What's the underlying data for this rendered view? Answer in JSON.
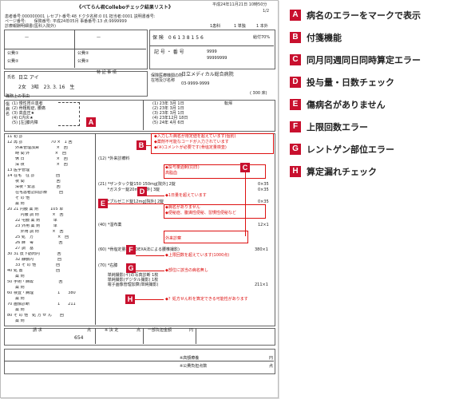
{
  "document": {
    "title": "《べてらん君Colleboチェック結果リスト》",
    "date": "平成24年11月21日 10時50分",
    "page_no": "1/2",
    "meta_line1": "患者番号:000000001 レセプト番号:48 ドクタ名称:0 01 担当者:0001 説明書番号:",
    "meta_line2": "ページ番号:　　保険番号: 平成24年05月 事番番号:13 点:9999999",
    "insurer_label": "診療報酬明細書(医科入院外)",
    "ins_cols": [
      "1患科",
      "1 単独",
      "1 本外"
    ],
    "hoken": "保 険　0 6 1 3 8 1 5 6",
    "kyufu": "給付70%",
    "kigo": "記 号 ・ 番 号",
    "num1": "9999",
    "num2": "99999999",
    "kouhi1": "公費①",
    "kouhi2": "公費②",
    "patient_name_label": "氏名",
    "patient_name": "日立 アイ",
    "tokki": "特 記 事 項",
    "patient_sex": "2女　3昭　23. 3. 16　生",
    "shokumu": "職務上の事由",
    "hospital_label": "保険医療機関の所在地及び名称",
    "hospital_name": "日立メディカル総合病院",
    "hospital_tel": "03-9999-9999",
    "beds": "( 300 床)",
    "diseases": [
      "(1) 慢性胃炎患者",
      "(2) 骨粗鬆症, 腰痛",
      "(3) 高血圧★",
      "(4) C内炎★",
      "(5) [左]膝内障"
    ],
    "disease_dates": [
      "(1) 23年 3月 1日",
      "(2) 23年 3月 1日",
      "(3) 23年 3月 1日",
      "(4) 23年12月 18日",
      "(5) 24年 4月 6日"
    ],
    "tenki": "転帰",
    "treat_lines": [
      "11 初 診",
      "12 再 診　　　　　　　70 ×　1 回",
      "　　外来管理加算　　　　 ×　回",
      "　　時 間 外　　　　　　 ×　回",
      "　　休 日　　　　　　　　×　回",
      "　　深 夜　　　　　　　　×　回",
      "13 医学管理",
      "14 在宅　往 診　　　　　 回",
      "　　夜 間　　　　　　　　回",
      "　　深夜・緊急　　　　　 回",
      "　　在宅患者訪問診療　　　回",
      "　　そ の 他",
      "　　薬 剤",
      "20 21 内服 薬 剤　　　105 単",
      "　　　 内服 調 剤　　　 ×　回",
      "　　22 屯服 薬 剤　　　 単",
      "　　23 外用 薬 剤　　　 単",
      "　　　 外用 調 剤　　　 ×　回",
      "　　25 処　方　　　　　　×　回",
      "　　26 麻　毒　　　　　　 回",
      "　　27 調　基",
      "30 31 皮下筋肉内　　　　 回",
      "　　32 静脈内　　　　　　回",
      "　　33 そ の 他　　　　　回",
      "40 処 置　　　　　　　　 回",
      "　　薬 剤",
      "50 手術・麻酔　　　　　　 回",
      "　　薬 剤",
      "60 検査・病理　　　　　　1　　380",
      "　　薬 剤",
      "70 画像診断　　　　　　　1　　211",
      "　　薬 剤",
      "80 そ の 他　処 方 せ ん　　回",
      "　　薬 剤"
    ],
    "right_lines": [
      "(12) *外来診療料",
      "(21) *ザンタック錠150 150mg[院外] 2錠",
      "　　 *ガスター錠20mg[院外] 3錠",
      "　　 *プルゼニド錠12mg[院外] 2錠",
      "(40) *湿布薬",
      "(60) *骨塩定量検査(DEXA法による腰椎撮影)",
      "(70) *右膝",
      "　　 単純撮影(イ)の写真診断 1枚",
      "　　 単純撮影(デジタル撮影) 1枚",
      "　　 電子画像管理加算(単純撮影)"
    ],
    "right_values": [
      "0×35",
      "0×35",
      "0×35",
      "12×1",
      "380×1",
      "211×1"
    ],
    "red_notes": [
      "◆入力した病名が限定値を超えています(個別)",
      "◆薬剤不可能なコードが入力されています",
      "◆(※)コメントが必要です(骨塩定量検査)",
      "◆投与量過剰(同日)",
      "◆1日量を超えています",
      "◆病名がありません",
      "◆便秘症、腹満性便秘、習慣性便秘など",
      "◆上限回数を超えています(1000点)",
      "◆部位に該当の病名無し",
      "◆？処方せん料を算定できる可能性があります"
    ],
    "sub_notes": [
      "高脂血",
      "外来診察",
      "高脂量"
    ],
    "summary_headers": [
      "請 求",
      "点",
      "※ 決 定",
      "点",
      "一部負担金額",
      "円"
    ],
    "summary_total": "654",
    "footer": [
      "※高額療養",
      "円",
      "※公費負担点数",
      "点",
      "※公費負担点数",
      "点"
    ]
  },
  "callouts": [
    "A",
    "B",
    "C",
    "D",
    "E",
    "F",
    "G",
    "H"
  ],
  "legend": [
    {
      "letter": "A",
      "label": "病名のエラーをマークで表示"
    },
    {
      "letter": "B",
      "label": "付箋機能"
    },
    {
      "letter": "C",
      "label": "同月同週同日同時算定エラー"
    },
    {
      "letter": "D",
      "label": "投与量・日数チェック"
    },
    {
      "letter": "E",
      "label": "傷病名がありません"
    },
    {
      "letter": "F",
      "label": "上限回数エラー"
    },
    {
      "letter": "G",
      "label": "レントゲン部位エラー"
    },
    {
      "letter": "H",
      "label": "算定漏れチェック"
    }
  ],
  "colors": {
    "accent": "#c8102e",
    "error_text": "#dd1111"
  }
}
